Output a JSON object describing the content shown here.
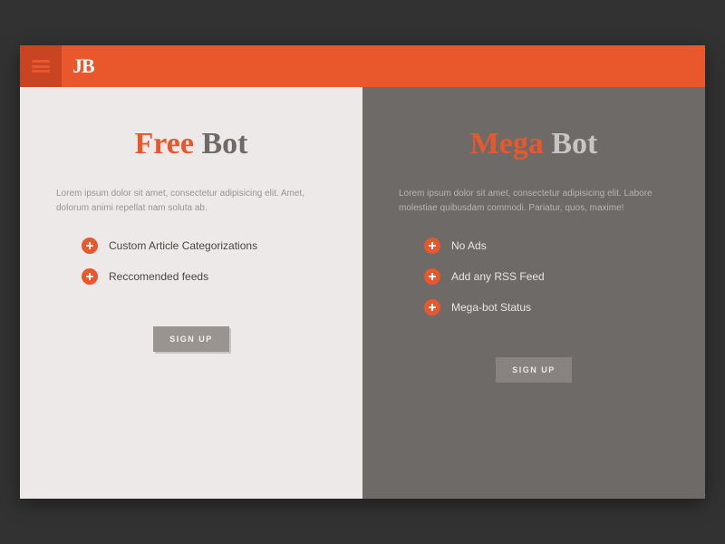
{
  "header": {
    "logo_text": "JB"
  },
  "plans": {
    "free": {
      "title_accent": "Free",
      "title_rest": " Bot",
      "description": "Lorem ipsum dolor sit amet, consectetur adipisicing elit. Amet, dolorum animi repellat nam soluta ab.",
      "features": [
        "Custom Article Categorizations",
        "Reccomended feeds"
      ],
      "cta": "SIGN UP"
    },
    "mega": {
      "title_accent": "Mega",
      "title_rest": " Bot",
      "description": "Lorem ipsum dolor sit amet, consectetur adipisicing elit. Labore molestiae quibusdam commodi. Pariatur, quos, maxime!",
      "features": [
        "No Ads",
        "Add any RSS Feed",
        "Mega-bot Status"
      ],
      "cta": "SIGN UP"
    }
  },
  "colors": {
    "accent": "#e8582c",
    "header_dark": "#c94423",
    "panel_light": "#ece9e8",
    "panel_dark": "#6e6a68"
  }
}
